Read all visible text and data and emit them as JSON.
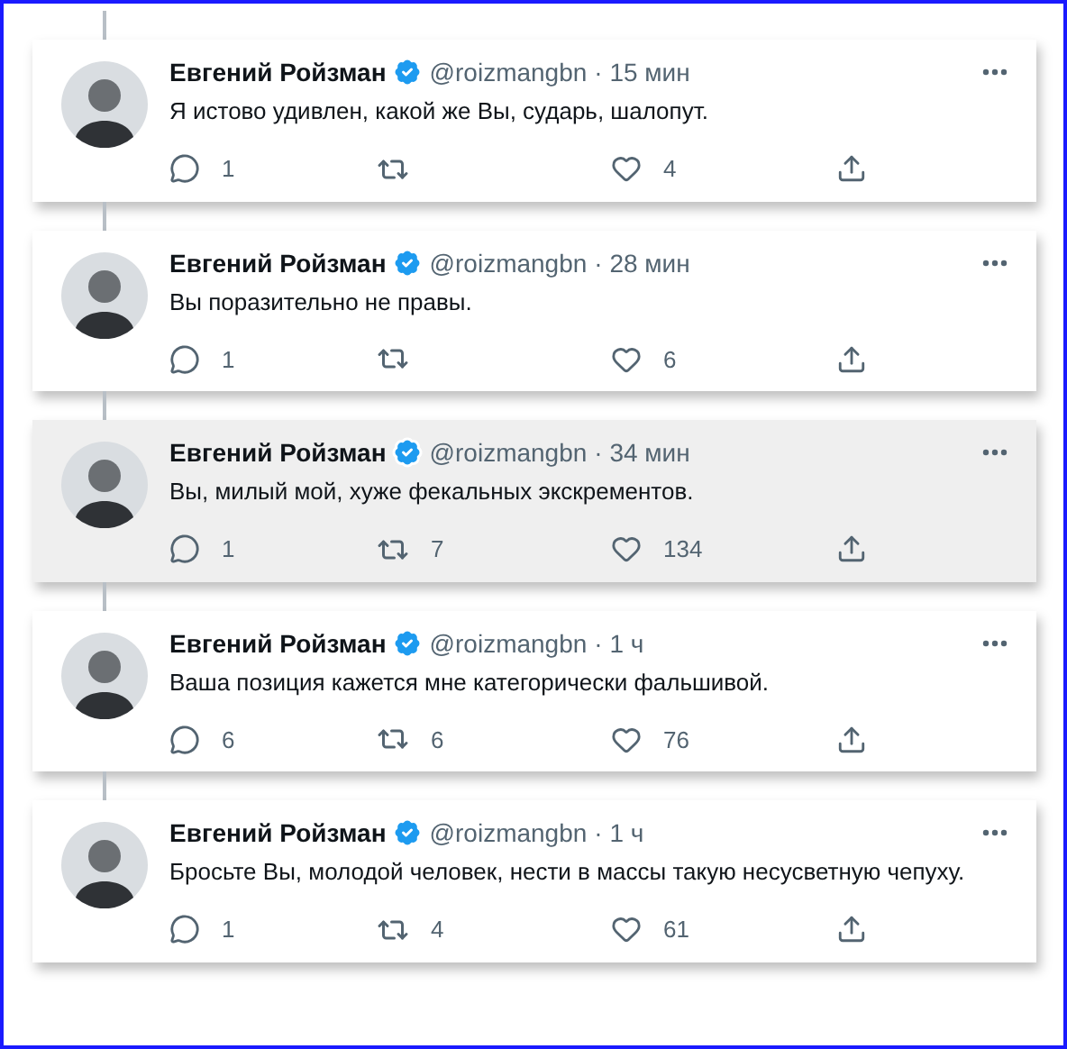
{
  "tweets": [
    {
      "name": "Евгений Ройзман",
      "handle": "@roizmangbn",
      "time": "· 15 мин",
      "text": "Я истово удивлен, какой же Вы, сударь, шалопут.",
      "replies": "1",
      "likes": "4",
      "highlighted": false
    },
    {
      "name": "Евгений Ройзман",
      "handle": "@roizmangbn",
      "time": "· 28 мин",
      "text": "Вы поразительно не правы.",
      "replies": "1",
      "likes": "6",
      "highlighted": false
    },
    {
      "name": "Евгений Ройзман",
      "handle": "@roizmangbn",
      "time": "· 34 мин",
      "text": "Вы, милый мой, хуже фекальных экскрементов.",
      "replies": "1",
      "retweets": "7",
      "likes": "134",
      "highlighted": true
    },
    {
      "name": "Евгений Ройзман",
      "handle": "@roizmangbn",
      "time": "· 1 ч",
      "text": "Ваша позиция кажется мне категорически фальшивой.",
      "replies": "6",
      "retweets": "6",
      "likes": "76",
      "highlighted": false
    },
    {
      "name": "Евгений Ройзман",
      "handle": "@roizmangbn",
      "time": "· 1 ч",
      "text": "Бросьте Вы, молодой человек, нести в массы такую несусветную чепуху.",
      "replies": "1",
      "retweets": "4",
      "likes": "61",
      "highlighted": false
    }
  ]
}
